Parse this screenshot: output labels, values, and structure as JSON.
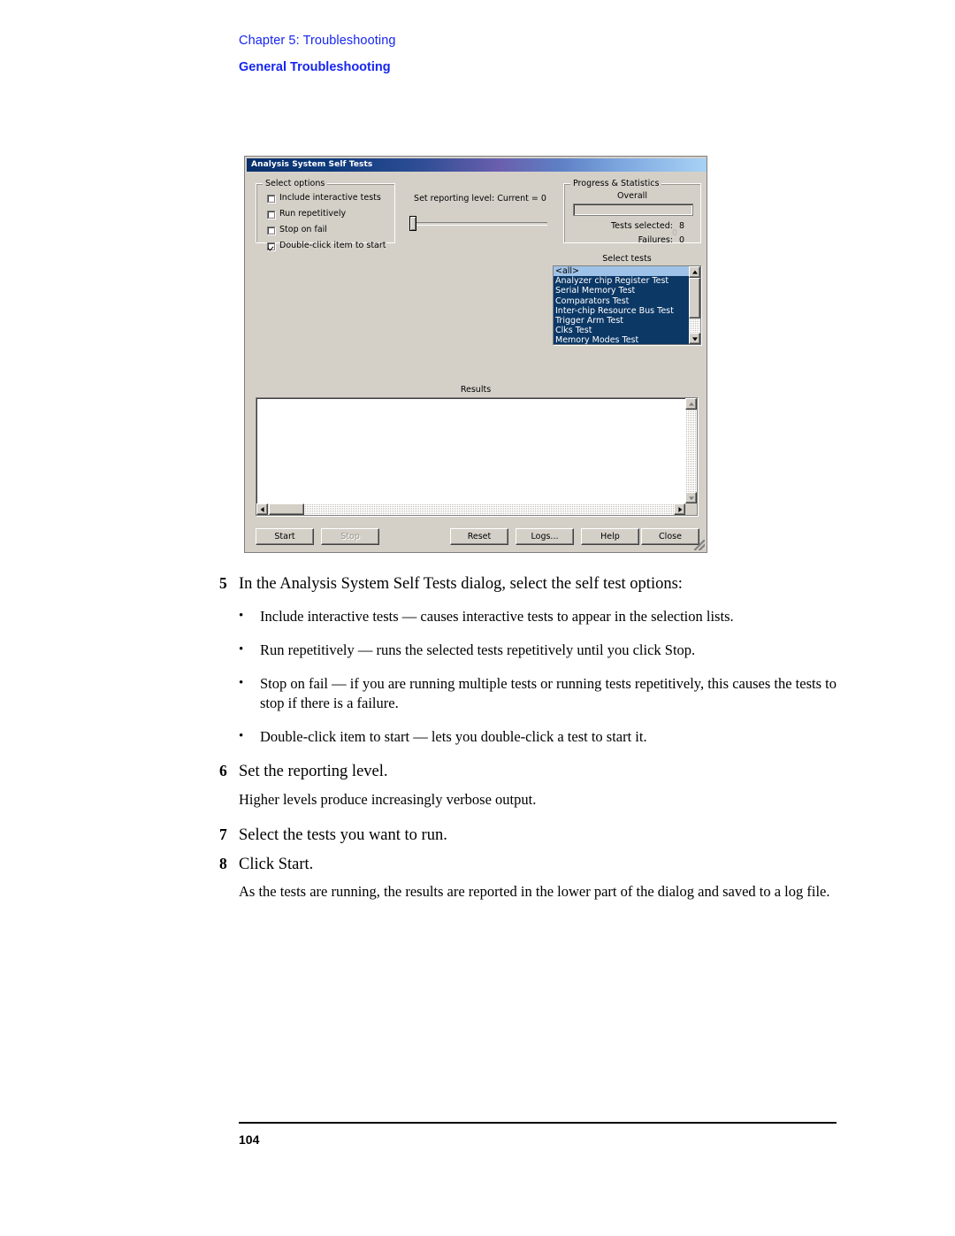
{
  "header": {
    "chapter_prefix": "Chapter",
    "chapter_line": "Chapter 5: Troubleshooting",
    "section_line": "General Troubleshooting"
  },
  "dialog": {
    "title": "Analysis System Self Tests",
    "select_options": {
      "legend": "Select options",
      "checkboxes": [
        {
          "label": "Include interactive tests",
          "checked": false
        },
        {
          "label": "Run repetitively",
          "checked": false
        },
        {
          "label": "Stop on fail",
          "checked": false
        },
        {
          "label": "Double-click item to start",
          "checked": true
        }
      ]
    },
    "reporting": {
      "caption": "Set reporting level: Current = 0",
      "value": 0
    },
    "progress": {
      "legend": "Progress & Statistics",
      "overall_label": "Overall",
      "progress_percent": 0,
      "tests_selected_label": "Tests selected:",
      "tests_selected_value": "8",
      "middle_faint_value": "0",
      "failures_label": "Failures:",
      "failures_value": "0"
    },
    "select_tests": {
      "label": "Select tests",
      "items": [
        {
          "label": "<all>",
          "state": "focused"
        },
        {
          "label": "Analyzer chip Register Test",
          "state": "selected"
        },
        {
          "label": "Serial Memory Test",
          "state": "selected"
        },
        {
          "label": "Comparators Test",
          "state": "selected"
        },
        {
          "label": "Inter-chip Resource Bus Test",
          "state": "selected"
        },
        {
          "label": "Trigger Arm Test",
          "state": "selected"
        },
        {
          "label": "Clks Test",
          "state": "selected"
        },
        {
          "label": "Memory Modes Test",
          "state": "selected"
        }
      ]
    },
    "results": {
      "label": "Results",
      "content": ""
    },
    "buttons": [
      {
        "name": "start",
        "label": "Start",
        "disabled": false
      },
      {
        "name": "stop",
        "label": "Stop",
        "disabled": true
      },
      {
        "name": "reset",
        "label": "Reset",
        "disabled": false
      },
      {
        "name": "logs",
        "label": "Logs...",
        "disabled": false
      },
      {
        "name": "help",
        "label": "Help",
        "disabled": false
      },
      {
        "name": "close",
        "label": "Close",
        "disabled": false
      }
    ]
  },
  "body": {
    "step5": {
      "num": "5",
      "text": "In the Analysis System Self Tests dialog, select the self test options:"
    },
    "bullets": [
      "Include interactive tests — causes interactive tests to appear in the selection lists.",
      "Run repetitively — runs the selected tests repetitively until you click Stop.",
      "Stop on fail — if you are running multiple tests or running tests repetitively, this causes the tests to stop if there is a failure.",
      "Double-click item to start — lets you double-click a test to start it."
    ],
    "step6": {
      "num": "6",
      "text": "Set the reporting level."
    },
    "step6_para": "Higher levels produce increasingly verbose output.",
    "step7": {
      "num": "7",
      "text": "Select the tests you want to run."
    },
    "step8": {
      "num": "8",
      "text": "Click Start."
    },
    "step8_para": "As the tests are running, the results are reported in the lower part of the dialog and saved to a log file."
  },
  "footer": {
    "page_number": "104"
  },
  "colors": {
    "heading_blue": "#1726f0",
    "dialog_face": "#d4d0c8",
    "list_selected": "#0c3866",
    "list_focused": "#9fc3e8"
  }
}
